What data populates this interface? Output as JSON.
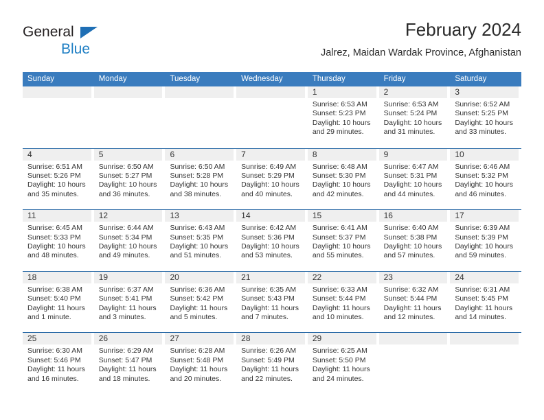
{
  "logo": {
    "line1": "General",
    "line2": "Blue",
    "triangle_color": "#1f6fb5",
    "blue_color": "#1f7fc4"
  },
  "header": {
    "title": "February 2024",
    "subtitle": "Jalrez, Maidan Wardak Province, Afghanistan"
  },
  "theme": {
    "header_bg": "#3a7cbe",
    "week_divider": "#2e6da8",
    "day_band_bg": "#efefef",
    "text": "#333333"
  },
  "weekdays": [
    "Sunday",
    "Monday",
    "Tuesday",
    "Wednesday",
    "Thursday",
    "Friday",
    "Saturday"
  ],
  "weeks": [
    [
      {
        "blank": true
      },
      {
        "blank": true
      },
      {
        "blank": true
      },
      {
        "blank": true
      },
      {
        "day": "1",
        "sunrise": "Sunrise: 6:53 AM",
        "sunset": "Sunset: 5:23 PM",
        "daylight": "Daylight: 10 hours and 29 minutes."
      },
      {
        "day": "2",
        "sunrise": "Sunrise: 6:53 AM",
        "sunset": "Sunset: 5:24 PM",
        "daylight": "Daylight: 10 hours and 31 minutes."
      },
      {
        "day": "3",
        "sunrise": "Sunrise: 6:52 AM",
        "sunset": "Sunset: 5:25 PM",
        "daylight": "Daylight: 10 hours and 33 minutes."
      }
    ],
    [
      {
        "day": "4",
        "sunrise": "Sunrise: 6:51 AM",
        "sunset": "Sunset: 5:26 PM",
        "daylight": "Daylight: 10 hours and 35 minutes."
      },
      {
        "day": "5",
        "sunrise": "Sunrise: 6:50 AM",
        "sunset": "Sunset: 5:27 PM",
        "daylight": "Daylight: 10 hours and 36 minutes."
      },
      {
        "day": "6",
        "sunrise": "Sunrise: 6:50 AM",
        "sunset": "Sunset: 5:28 PM",
        "daylight": "Daylight: 10 hours and 38 minutes."
      },
      {
        "day": "7",
        "sunrise": "Sunrise: 6:49 AM",
        "sunset": "Sunset: 5:29 PM",
        "daylight": "Daylight: 10 hours and 40 minutes."
      },
      {
        "day": "8",
        "sunrise": "Sunrise: 6:48 AM",
        "sunset": "Sunset: 5:30 PM",
        "daylight": "Daylight: 10 hours and 42 minutes."
      },
      {
        "day": "9",
        "sunrise": "Sunrise: 6:47 AM",
        "sunset": "Sunset: 5:31 PM",
        "daylight": "Daylight: 10 hours and 44 minutes."
      },
      {
        "day": "10",
        "sunrise": "Sunrise: 6:46 AM",
        "sunset": "Sunset: 5:32 PM",
        "daylight": "Daylight: 10 hours and 46 minutes."
      }
    ],
    [
      {
        "day": "11",
        "sunrise": "Sunrise: 6:45 AM",
        "sunset": "Sunset: 5:33 PM",
        "daylight": "Daylight: 10 hours and 48 minutes."
      },
      {
        "day": "12",
        "sunrise": "Sunrise: 6:44 AM",
        "sunset": "Sunset: 5:34 PM",
        "daylight": "Daylight: 10 hours and 49 minutes."
      },
      {
        "day": "13",
        "sunrise": "Sunrise: 6:43 AM",
        "sunset": "Sunset: 5:35 PM",
        "daylight": "Daylight: 10 hours and 51 minutes."
      },
      {
        "day": "14",
        "sunrise": "Sunrise: 6:42 AM",
        "sunset": "Sunset: 5:36 PM",
        "daylight": "Daylight: 10 hours and 53 minutes."
      },
      {
        "day": "15",
        "sunrise": "Sunrise: 6:41 AM",
        "sunset": "Sunset: 5:37 PM",
        "daylight": "Daylight: 10 hours and 55 minutes."
      },
      {
        "day": "16",
        "sunrise": "Sunrise: 6:40 AM",
        "sunset": "Sunset: 5:38 PM",
        "daylight": "Daylight: 10 hours and 57 minutes."
      },
      {
        "day": "17",
        "sunrise": "Sunrise: 6:39 AM",
        "sunset": "Sunset: 5:39 PM",
        "daylight": "Daylight: 10 hours and 59 minutes."
      }
    ],
    [
      {
        "day": "18",
        "sunrise": "Sunrise: 6:38 AM",
        "sunset": "Sunset: 5:40 PM",
        "daylight": "Daylight: 11 hours and 1 minute."
      },
      {
        "day": "19",
        "sunrise": "Sunrise: 6:37 AM",
        "sunset": "Sunset: 5:41 PM",
        "daylight": "Daylight: 11 hours and 3 minutes."
      },
      {
        "day": "20",
        "sunrise": "Sunrise: 6:36 AM",
        "sunset": "Sunset: 5:42 PM",
        "daylight": "Daylight: 11 hours and 5 minutes."
      },
      {
        "day": "21",
        "sunrise": "Sunrise: 6:35 AM",
        "sunset": "Sunset: 5:43 PM",
        "daylight": "Daylight: 11 hours and 7 minutes."
      },
      {
        "day": "22",
        "sunrise": "Sunrise: 6:33 AM",
        "sunset": "Sunset: 5:44 PM",
        "daylight": "Daylight: 11 hours and 10 minutes."
      },
      {
        "day": "23",
        "sunrise": "Sunrise: 6:32 AM",
        "sunset": "Sunset: 5:44 PM",
        "daylight": "Daylight: 11 hours and 12 minutes."
      },
      {
        "day": "24",
        "sunrise": "Sunrise: 6:31 AM",
        "sunset": "Sunset: 5:45 PM",
        "daylight": "Daylight: 11 hours and 14 minutes."
      }
    ],
    [
      {
        "day": "25",
        "sunrise": "Sunrise: 6:30 AM",
        "sunset": "Sunset: 5:46 PM",
        "daylight": "Daylight: 11 hours and 16 minutes."
      },
      {
        "day": "26",
        "sunrise": "Sunrise: 6:29 AM",
        "sunset": "Sunset: 5:47 PM",
        "daylight": "Daylight: 11 hours and 18 minutes."
      },
      {
        "day": "27",
        "sunrise": "Sunrise: 6:28 AM",
        "sunset": "Sunset: 5:48 PM",
        "daylight": "Daylight: 11 hours and 20 minutes."
      },
      {
        "day": "28",
        "sunrise": "Sunrise: 6:26 AM",
        "sunset": "Sunset: 5:49 PM",
        "daylight": "Daylight: 11 hours and 22 minutes."
      },
      {
        "day": "29",
        "sunrise": "Sunrise: 6:25 AM",
        "sunset": "Sunset: 5:50 PM",
        "daylight": "Daylight: 11 hours and 24 minutes."
      },
      {
        "blank": true
      },
      {
        "blank": true
      }
    ]
  ]
}
